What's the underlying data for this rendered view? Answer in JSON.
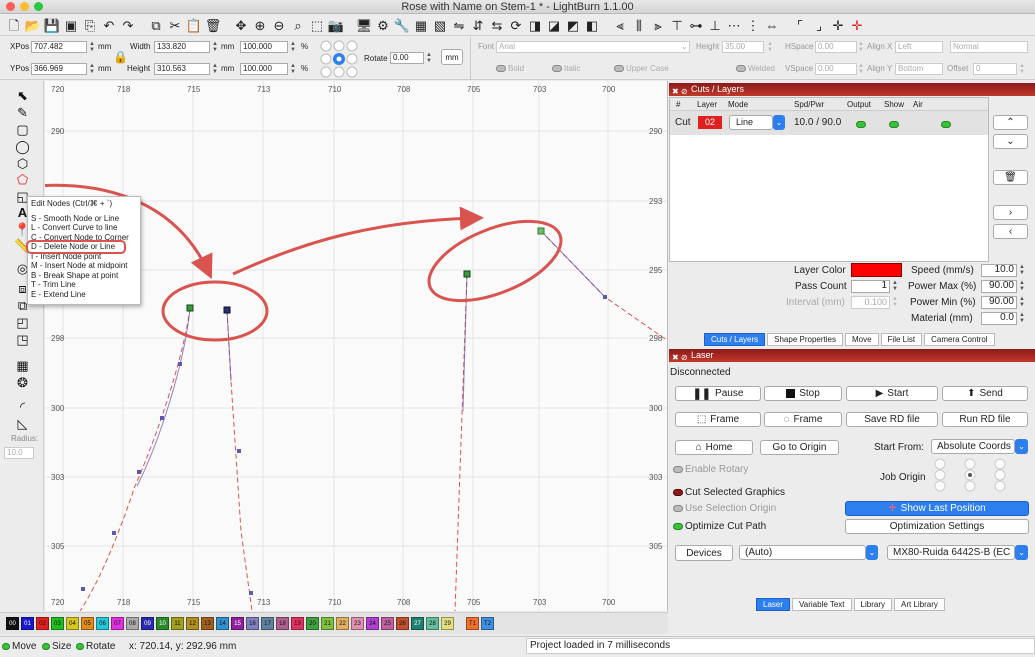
{
  "window": {
    "title": "Rose with Name on Stem-1 * - LightBurn 1.1.00"
  },
  "props": {
    "xpos_label": "XPos",
    "xpos": "707.482",
    "ypos_label": "YPos",
    "ypos": "366.969",
    "unit": "mm",
    "width_label": "Width",
    "width": "133.820",
    "height_label": "Height",
    "height": "310.563",
    "scale_w": "100.000",
    "scale_h": "100.000",
    "pct": "%",
    "rotate_label": "Rotate",
    "rotate": "0.00",
    "mm_button": "mm",
    "font_label": "Font",
    "font": "Arial",
    "fheight_label": "Height",
    "fheight": "35.00",
    "hspace_label": "HSpace",
    "hspace": "0.00",
    "vspace_label": "VSpace",
    "vspace": "0.00",
    "alignx_label": "Align X",
    "alignx": "Left",
    "aligny_label": "Align Y",
    "aligny": "Bottom",
    "style": "Normal",
    "offset_label": "Offset",
    "offset": "0",
    "bold": "Bold",
    "italic": "Italic",
    "uppercase": "Upper Case",
    "welded": "Welded"
  },
  "lefttools": {
    "radius_label": "Radius:",
    "radius": "10.0"
  },
  "ruler": {
    "top": [
      "720",
      "718",
      "715",
      "713",
      "710",
      "708",
      "705",
      "703",
      "700"
    ],
    "left": [
      "290",
      "293",
      "295",
      "298",
      "300",
      "303",
      "305"
    ],
    "right": [
      "290",
      "293",
      "295",
      "298",
      "300",
      "303",
      "305"
    ],
    "bottom": [
      "720",
      "718",
      "715",
      "713",
      "710",
      "708",
      "705",
      "703",
      "700"
    ]
  },
  "menu": {
    "items": [
      "Edit Nodes (Ctrl/⌘ + `)",
      "S - Smooth Node or Line",
      "L - Convert Curve to line",
      "C - Convert Node to Corner",
      "D - Delete Node or Line",
      "I - Insert Node point",
      "M - Insert Node at midpoint",
      "B - Break Shape at point",
      "T - Trim Line",
      "E - Extend Line"
    ]
  },
  "cuts": {
    "title": "Cuts / Layers",
    "headers": [
      "#",
      "Layer",
      "Mode",
      "Spd/Pwr",
      "Output",
      "Show",
      "Air"
    ],
    "row": {
      "name": "Cut",
      "layer": "02",
      "mode": "Line",
      "spdpwr": "10.0 / 90.0"
    },
    "layer_color_label": "Layer Color",
    "layer_color": "#ff0000",
    "pass_label": "Pass Count",
    "pass": "1",
    "interval_label": "Interval (mm)",
    "interval": "0.100",
    "speed_label": "Speed (mm/s)",
    "speed": "10.0",
    "pmax_label": "Power Max (%)",
    "pmax": "90.00",
    "pmin_label": "Power Min (%)",
    "pmin": "90.00",
    "material_label": "Material (mm)",
    "material": "0.0",
    "tabs": [
      "Cuts / Layers",
      "Shape Properties",
      "Move",
      "File List",
      "Camera Control"
    ]
  },
  "laser": {
    "title": "Laser",
    "state": "Disconnected",
    "pause": "Pause",
    "stop": "Stop",
    "start": "Start",
    "send": "Send",
    "frame1": "Frame",
    "frame2": "Frame",
    "save_rd": "Save RD file",
    "run_rd": "Run RD file",
    "home": "Home",
    "goto_origin": "Go to Origin",
    "start_from_label": "Start From:",
    "start_from": "Absolute Coords",
    "enable_rotary": "Enable Rotary",
    "job_origin": "Job Origin",
    "cut_selected": "Cut Selected Graphics",
    "use_selection_origin": "Use Selection Origin",
    "show_last_position": "Show Last Position",
    "optimize": "Optimize Cut Path",
    "optimization_settings": "Optimization Settings",
    "devices": "Devices",
    "device_port": "(Auto)",
    "device_name": "MX80-Ruida 6442S-B (EC",
    "tabs": [
      "Laser",
      "Variable Text",
      "Library",
      "Art Library"
    ]
  },
  "palette": [
    {
      "n": "00",
      "c": "#111111"
    },
    {
      "n": "01",
      "c": "#1a1acc"
    },
    {
      "n": "02",
      "c": "#e02020"
    },
    {
      "n": "03",
      "c": "#1fbf1f"
    },
    {
      "n": "04",
      "c": "#d6c820"
    },
    {
      "n": "05",
      "c": "#e08a1a"
    },
    {
      "n": "06",
      "c": "#22c8d8"
    },
    {
      "n": "07",
      "c": "#e030e0"
    },
    {
      "n": "08",
      "c": "#aaaaaa"
    },
    {
      "n": "09",
      "c": "#2a2ab0"
    },
    {
      "n": "10",
      "c": "#2a8a2a"
    },
    {
      "n": "11",
      "c": "#a0a020"
    },
    {
      "n": "12",
      "c": "#b09020"
    },
    {
      "n": "13",
      "c": "#a06020"
    },
    {
      "n": "14",
      "c": "#3090d0"
    },
    {
      "n": "15",
      "c": "#9020a0"
    },
    {
      "n": "16",
      "c": "#8080c0"
    },
    {
      "n": "17",
      "c": "#6080a0"
    },
    {
      "n": "18",
      "c": "#b06090"
    },
    {
      "n": "19",
      "c": "#e03060"
    },
    {
      "n": "20",
      "c": "#40a040"
    },
    {
      "n": "21",
      "c": "#80c040"
    },
    {
      "n": "22",
      "c": "#e0b060"
    },
    {
      "n": "23",
      "c": "#e090b0"
    },
    {
      "n": "24",
      "c": "#b040d0"
    },
    {
      "n": "25",
      "c": "#c060a0"
    },
    {
      "n": "26",
      "c": "#c05030"
    },
    {
      "n": "27",
      "c": "#208070"
    },
    {
      "n": "28",
      "c": "#60c0a0"
    },
    {
      "n": "29",
      "c": "#e0e080"
    },
    {
      "n": "T1",
      "c": "#f07030"
    },
    {
      "n": "T2",
      "c": "#4090e0"
    }
  ],
  "status": {
    "move": "Move",
    "size": "Size",
    "rotate": "Rotate",
    "coords": "x: 720.14, y: 292.96 mm",
    "message": "Project loaded in 7 milliseconds"
  }
}
